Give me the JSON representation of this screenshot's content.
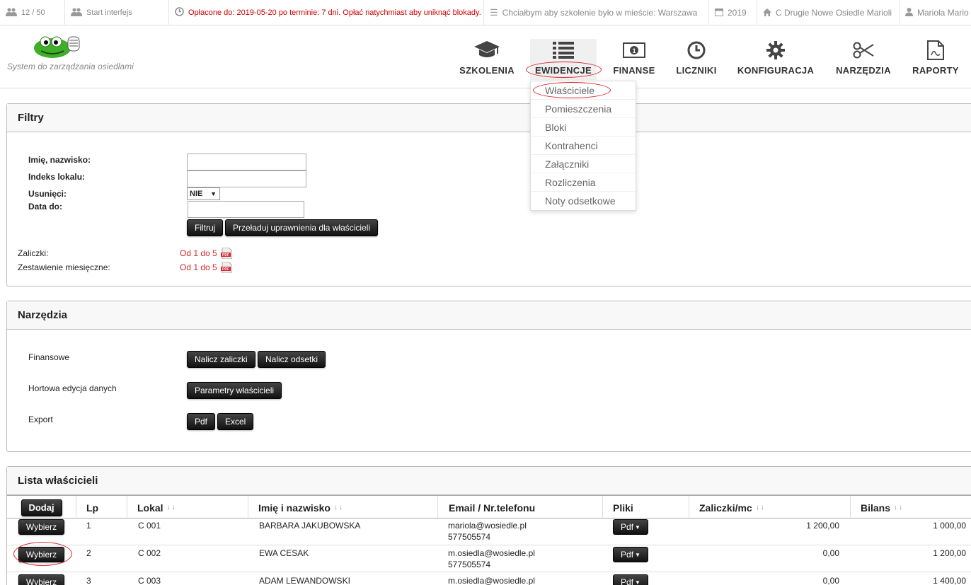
{
  "topbar": {
    "users": "12 / 50",
    "start": "Start interfejs",
    "paid": "Opłacone do: 2019-05-20 po terminie: 7 dni. Opłać natychmiast aby uniknąć blokady.",
    "training": "Chciałbym aby szkolenie było w mieście: Warszawa",
    "year": "2019",
    "estate": "C Drugie Nowe Osiedle Marioli",
    "user": "Mariola Mario"
  },
  "logo": {
    "text": "System do zarządzania osiedlami"
  },
  "menu": {
    "szkolenia": "SZKOLENIA",
    "ewidencje": "EWIDENCJE",
    "finanse": "FINANSE",
    "liczniki": "LICZNIKI",
    "konfiguracja": "KONFIGURACJA",
    "narzedzia": "NARZĘDZIA",
    "raporty": "RAPORTY"
  },
  "dropdown": [
    "Właściciele",
    "Pomieszczenia",
    "Bloki",
    "Kontrahenci",
    "Załączniki",
    "Rozliczenia",
    "Noty odsetkowe"
  ],
  "filters": {
    "title": "Filtry",
    "name_label": "Imię, nazwisko:",
    "index_label": "Indeks lokalu:",
    "deleted_label": "Usunięci:",
    "deleted_value": "NIE",
    "date_label": "Data do:",
    "filter_btn": "Filtruj",
    "reload_btn": "Przeładuj uprawnienia dla właścicieli",
    "advances_label": "Zaliczki:",
    "advances_link": "Od 1 do 5",
    "monthly_label": "Zestawienie miesięczne:",
    "monthly_link": "Od 1 do 5"
  },
  "tools": {
    "title": "Narzędzia",
    "finance_label": "Finansowe",
    "advances_btn": "Nalicz zaliczki",
    "interest_btn": "Nalicz odsetki",
    "bulk_label": "Hortowa edycja danych",
    "params_btn": "Parametry właścicieli",
    "export_label": "Export",
    "pdf_btn": "Pdf",
    "excel_btn": "Excel"
  },
  "list": {
    "title": "Lista właścicieli",
    "add_btn": "Dodaj",
    "headers": {
      "lp": "Lp",
      "lokal": "Lokal",
      "name": "Imię i nazwisko",
      "email": "Email / Nr.telefonu",
      "files": "Pliki",
      "advances": "Zaliczki/mc",
      "balance": "Bilans"
    },
    "select_btn": "Wybierz",
    "pdf_label": "Pdf",
    "rows": [
      {
        "lp": "1",
        "lokal": "C 001",
        "name": "BARBARA JAKUBOWSKA",
        "email": "mariola@wosiedle.pl",
        "phone": "577505574",
        "advances": "1 200,00",
        "balance": "1 000,00"
      },
      {
        "lp": "2",
        "lokal": "C 002",
        "name": "EWA CESAK",
        "email": "m.osiedla@wosiedle.pl",
        "phone": "577505574",
        "advances": "0,00",
        "balance": "1 200,00"
      },
      {
        "lp": "3",
        "lokal": "C 003",
        "name": "ADAM LEWANDOWSKI",
        "email": "m.osiedla@wosiedle.pl",
        "phone": "",
        "advances": "0,00",
        "balance": "1 400,00"
      }
    ]
  }
}
